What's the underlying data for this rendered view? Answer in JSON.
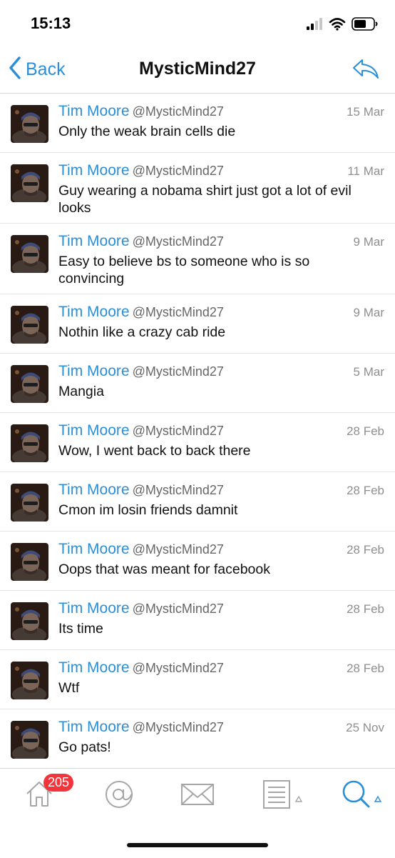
{
  "status_bar": {
    "time": "15:13"
  },
  "nav": {
    "back_label": "Back",
    "title": "MysticMind27"
  },
  "tweets": [
    {
      "name": "Tim Moore",
      "handle": "@MysticMind27",
      "date": "15 Mar",
      "text": "Only the weak brain cells die"
    },
    {
      "name": "Tim Moore",
      "handle": "@MysticMind27",
      "date": "11 Mar",
      "text": "Guy wearing a nobama shirt just got a lot of evil looks"
    },
    {
      "name": "Tim Moore",
      "handle": "@MysticMind27",
      "date": "9 Mar",
      "text": "Easy to believe bs to someone who is so convincing"
    },
    {
      "name": "Tim Moore",
      "handle": "@MysticMind27",
      "date": "9 Mar",
      "text": "Nothin like a crazy cab ride"
    },
    {
      "name": "Tim Moore",
      "handle": "@MysticMind27",
      "date": "5 Mar",
      "text": "Mangia"
    },
    {
      "name": "Tim Moore",
      "handle": "@MysticMind27",
      "date": "28 Feb",
      "text": "Wow, I went back to back there"
    },
    {
      "name": "Tim Moore",
      "handle": "@MysticMind27",
      "date": "28 Feb",
      "text": "Cmon im losin friends damnit"
    },
    {
      "name": "Tim Moore",
      "handle": "@MysticMind27",
      "date": "28 Feb",
      "text": "Oops that was meant for facebook"
    },
    {
      "name": "Tim Moore",
      "handle": "@MysticMind27",
      "date": "28 Feb",
      "text": "Its time"
    },
    {
      "name": "Tim Moore",
      "handle": "@MysticMind27",
      "date": "28 Feb",
      "text": "Wtf"
    },
    {
      "name": "Tim Moore",
      "handle": "@MysticMind27",
      "date": "25 Nov",
      "text": "Go pats!"
    }
  ],
  "tab_bar": {
    "home_badge": "205",
    "tabs": [
      "home-icon",
      "mentions-icon",
      "messages-icon",
      "lists-icon",
      "search-icon"
    ]
  },
  "colors": {
    "accent": "#2b8fd8",
    "badge": "#f2353b"
  }
}
